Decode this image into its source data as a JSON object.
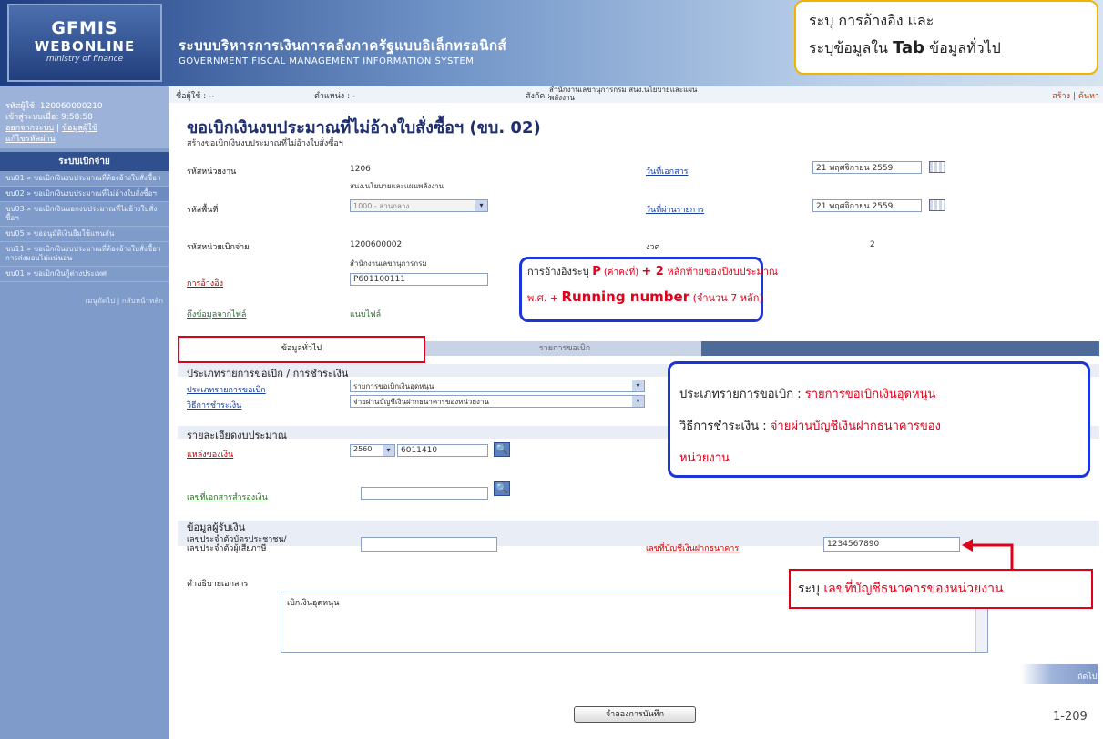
{
  "banner": {
    "logo_line1": "GFMIS",
    "logo_line2": "WEBONLINE",
    "logo_line3": "ministry of finance",
    "title_th": "ระบบบริหารการเงินการคลังภาครัฐแบบอิเล็กทรอนิกส์",
    "title_en": "GOVERNMENT FISCAL MANAGEMENT INFORMATION SYSTEM"
  },
  "callout_top": {
    "line1": "ระบุ การอ้างอิง และ",
    "line2_pre": "ระบุข้อมูลใน ",
    "line2_bold": "Tab",
    "line2_post": " ข้อมูลทั่วไป"
  },
  "sidebar": {
    "user_code": "รหัสผู้ใช้: 120060000210",
    "login_time": "เข้าสู่ระบบเมื่อ: 9:58:58",
    "logout": "ออกจากระบบ",
    "profile": "ข้อมูลผู้ใช้",
    "change_password": "แก้ไขรหัสผ่าน",
    "menu_title": "ระบบเบิกจ่าย",
    "items": [
      "ขบ01 » ขอเบิกเงินงบประมาณที่ต้องอ้างใบสั่งซื้อฯ",
      "ขบ02 » ขอเบิกเงินงบประมาณที่ไม่อ้างใบสั่งซื้อฯ",
      "ขบ03 » ขอเบิกเงินนอกงบประมาณที่ไม่อ้างใบสั่งซื้อฯ",
      "ขบ05 » ขออนุมัติเงินยืมใช้แทนกัน",
      "ขบ11 » ขอเบิกเงินงบประมาณที่ต้องอ้างใบสั่งซื้อฯ การส่งมอบไม่แน่นอน",
      "ขบ01 » ขอเบิกเงินกู้ต่างประเทศ"
    ],
    "footer": "เมนูถัดไป | กลับหน้าหลัก"
  },
  "topline": {
    "user": "ชื่อผู้ใช้ : --",
    "position": "ตำแหน่ง : -",
    "affiliation_label": "สังกัด :",
    "affiliation_l1": "สำนักงานเลขานุการกรม สนง.นโยบายและแผน",
    "affiliation_l2": "พลังงาน",
    "links": "สร้าง | ค้นหา"
  },
  "page": {
    "heading": "ขอเบิกเงินงบประมาณที่ไม่อ้างใบสั่งซื้อฯ (ขบ. 02)",
    "subheading": "สร้างขอเบิกเงินงบประมาณที่ไม่อ้างใบสั่งซื้อฯ"
  },
  "form": {
    "unit_code_label": "รหัสหน่วยงาน",
    "unit_code": "1206",
    "unit_name": "สนง.นโยบายและแผนพลังงาน",
    "area_code_label": "รหัสพื้นที่",
    "area_code": "1000 - ส่วนกลาง",
    "disb_unit_label": "รหัสหน่วยเบิกจ่าย",
    "disb_unit": "1200600002",
    "disb_unit_name": "สำนักงานเลขานุการกรม",
    "reference_label": "การอ้างอิง",
    "reference": "P601100111",
    "import_label": "ดึงข้อมูลจากไฟล์",
    "import_value": "แนบไฟล์",
    "doc_date_label": "วันที่เอกสาร",
    "doc_date": "21 พฤศจิกายน 2559",
    "post_date_label": "วันที่ผ่านรายการ",
    "post_date": "21 พฤศจิกายน 2559",
    "period_label": "งวด",
    "period": "2"
  },
  "tabs": {
    "general": "ข้อมูลทั่วไป",
    "items": "รายการขอเบิก"
  },
  "general": {
    "section1": "ประเภทรายการขอเบิก / การชำระเงิน",
    "type_label": "ประเภทรายการขอเบิก",
    "type_value": "รายการขอเบิกเงินอุดหนุน",
    "payment_label": "วิธีการชำระเงิน",
    "payment_value": "จ่ายผ่านบัญชีเงินฝากธนาคารของหน่วยงาน",
    "section2": "รายละเอียดงบประมาณ",
    "source_label": "แหล่งของเงิน",
    "source_year": "2560",
    "source_code": "6011410",
    "reserve_label": "เลขที่เอกสารสำรองเงิน",
    "reserve_value": "",
    "section3": "ข้อมูลผู้รับเงิน",
    "citizen_label1": "เลขประจำตัวบัตรประชาชน/",
    "citizen_label2": "เลขประจำตัวผู้เสียภาษี",
    "citizen_value": "",
    "bank_label": "เลขที่บัญชีเงินฝากธนาคาร",
    "bank_value": "1234567890",
    "desc_label": "คำอธิบายเอกสาร",
    "desc_value": "เบิกเงินอุดหนุน"
  },
  "next_label": "ถัดไป »",
  "save_button": "จำลองการบันทึก",
  "page_number": "1-209",
  "annotation_ref": {
    "pre": "การอ้างอิงระบุ ",
    "p": "P",
    "p_note": " (ค่าคงที่) ",
    "plus": "+ 2",
    "mid": " หลักท้ายของปีงบประมาณ",
    "line2_pre": "พ.ศ. + ",
    "running": "Running number",
    "line2_post": " (จำนวน 7 หลัก)"
  },
  "annotation_type": {
    "l1_label": "ประเภทรายการขอเบิก : ",
    "l1_value": "รายการขอเบิกเงินอุดหนุน",
    "l2_label": "วิธีการชำระเงิน : ",
    "l2_value": "จ่ายผ่านบัญชีเงินฝากธนาคารของ",
    "l3_value": "หน่วยงาน"
  },
  "annotation_bank": {
    "pre": "ระบุ ",
    "value": "เลขที่บัญชีธนาคารของหน่วยงาน"
  },
  "colors": {
    "accent_blue": "#1d35d6",
    "annotation_red": "#e0001a",
    "callout_border": "#f0b400"
  }
}
